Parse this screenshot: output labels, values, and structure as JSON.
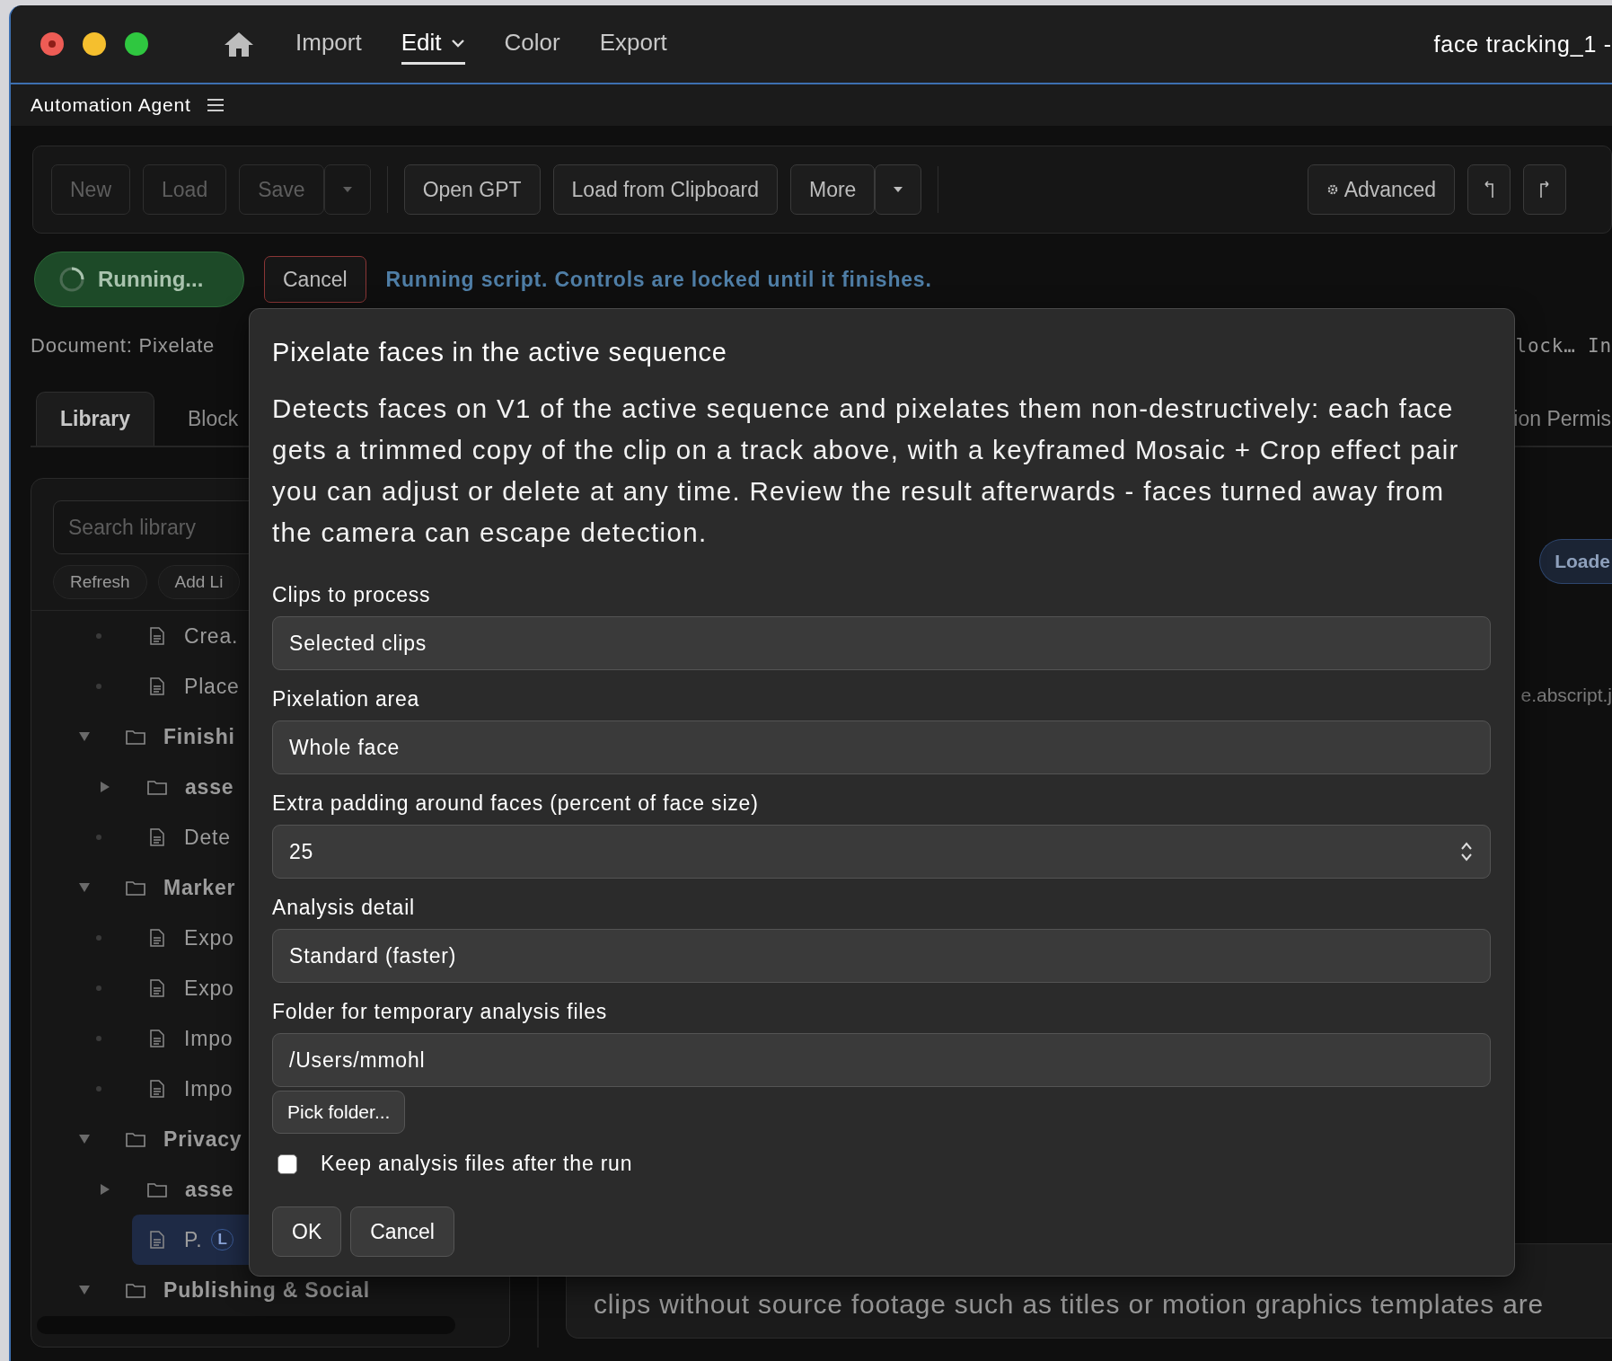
{
  "window": {
    "title": "face tracking_1 -"
  },
  "nav": [
    {
      "label": "Import",
      "selected": false,
      "menu": false
    },
    {
      "label": "Edit",
      "selected": true,
      "menu": true
    },
    {
      "label": "Color",
      "selected": false,
      "menu": false
    },
    {
      "label": "Export",
      "selected": false,
      "menu": false
    }
  ],
  "panel": {
    "title": "Automation Agent"
  },
  "toolbar": [
    {
      "kind": "button",
      "label": "New",
      "disabled": true
    },
    {
      "kind": "button",
      "label": "Load",
      "disabled": true
    },
    {
      "kind": "button",
      "label": "Save",
      "disabled": true
    },
    {
      "kind": "caret",
      "disabled": true
    },
    {
      "kind": "separator"
    },
    {
      "kind": "button",
      "label": "Open GPT",
      "disabled": false
    },
    {
      "kind": "button",
      "label": "Load from Clipboard",
      "disabled": false
    },
    {
      "kind": "button",
      "label": "More",
      "disabled": false
    },
    {
      "kind": "caret",
      "disabled": false
    },
    {
      "kind": "separator"
    },
    {
      "kind": "spacer"
    },
    {
      "kind": "advanced",
      "label": "Advanced",
      "disabled": false
    },
    {
      "kind": "undo",
      "disabled": false
    },
    {
      "kind": "redo",
      "disabled": false
    }
  ],
  "status": {
    "running": "Running...",
    "cancel": "Cancel",
    "message": "Running script. Controls are locked until it finishes."
  },
  "document": {
    "left": "Document: Pixelate",
    "right": "lock… In"
  },
  "tabs": [
    {
      "label": "Library",
      "selected": true
    },
    {
      "label": "Block",
      "selected": false
    },
    {
      "label": "ion Permis",
      "selected": false
    }
  ],
  "library": {
    "search": {
      "placeholder": "Search library"
    },
    "buttons": [
      "Refresh",
      "Add Li"
    ],
    "tree": [
      {
        "kind": "hidden-parent",
        "children": [
          {
            "kind": "file",
            "label": "Crea.",
            "selected": false
          },
          {
            "kind": "file",
            "label": "Place",
            "selected": false
          }
        ]
      },
      {
        "kind": "folder",
        "label": "Finishi",
        "expanded": true,
        "children": [
          {
            "kind": "folder",
            "label": "asse",
            "expanded": false
          },
          {
            "kind": "file",
            "label": "Dete",
            "selected": false
          }
        ]
      },
      {
        "kind": "folder",
        "label": "Marker",
        "expanded": true,
        "children": [
          {
            "kind": "file",
            "label": "Expo",
            "selected": false
          },
          {
            "kind": "file",
            "label": "Expo",
            "selected": false
          },
          {
            "kind": "file",
            "label": "Impo",
            "selected": false
          },
          {
            "kind": "file",
            "label": "Impo",
            "selected": false
          }
        ]
      },
      {
        "kind": "folder",
        "label": "Privacy",
        "expanded": true,
        "children": [
          {
            "kind": "folder",
            "label": "asse",
            "expanded": false
          },
          {
            "kind": "file",
            "label": "P.",
            "selected": true,
            "badge": "L"
          }
        ]
      },
      {
        "kind": "folder",
        "label": "Publishing & Social",
        "expanded": true
      }
    ]
  },
  "details": {
    "badge": "Loade",
    "file": "e.abscript.j",
    "description": "clips without source footage such as titles or motion graphics templates are"
  },
  "dialog": {
    "title": "Pixelate faces in the active sequence",
    "description": "Detects faces on V1 of the active sequence and pixelates them non-destructively: each face gets a trimmed copy of the clip on a track above, with a keyframed Mosaic + Crop effect pair you can adjust or delete at any time. Review the result afterwards - faces turned away from the camera can escape detection.",
    "fields": [
      {
        "kind": "select",
        "label": "Clips to process",
        "value": "Selected clips"
      },
      {
        "kind": "select",
        "label": "Pixelation area",
        "value": "Whole face"
      },
      {
        "kind": "number",
        "label": "Extra padding around faces (percent of face size)",
        "value": "25"
      },
      {
        "kind": "select",
        "label": "Analysis detail",
        "value": "Standard (faster)"
      },
      {
        "kind": "text",
        "label": "Folder for temporary analysis files",
        "value": "/Users/mmohl"
      }
    ],
    "pick_button": "Pick folder...",
    "checkbox": {
      "label": "Keep analysis files after the run",
      "checked": false
    },
    "buttons": [
      "OK",
      "Cancel"
    ]
  }
}
